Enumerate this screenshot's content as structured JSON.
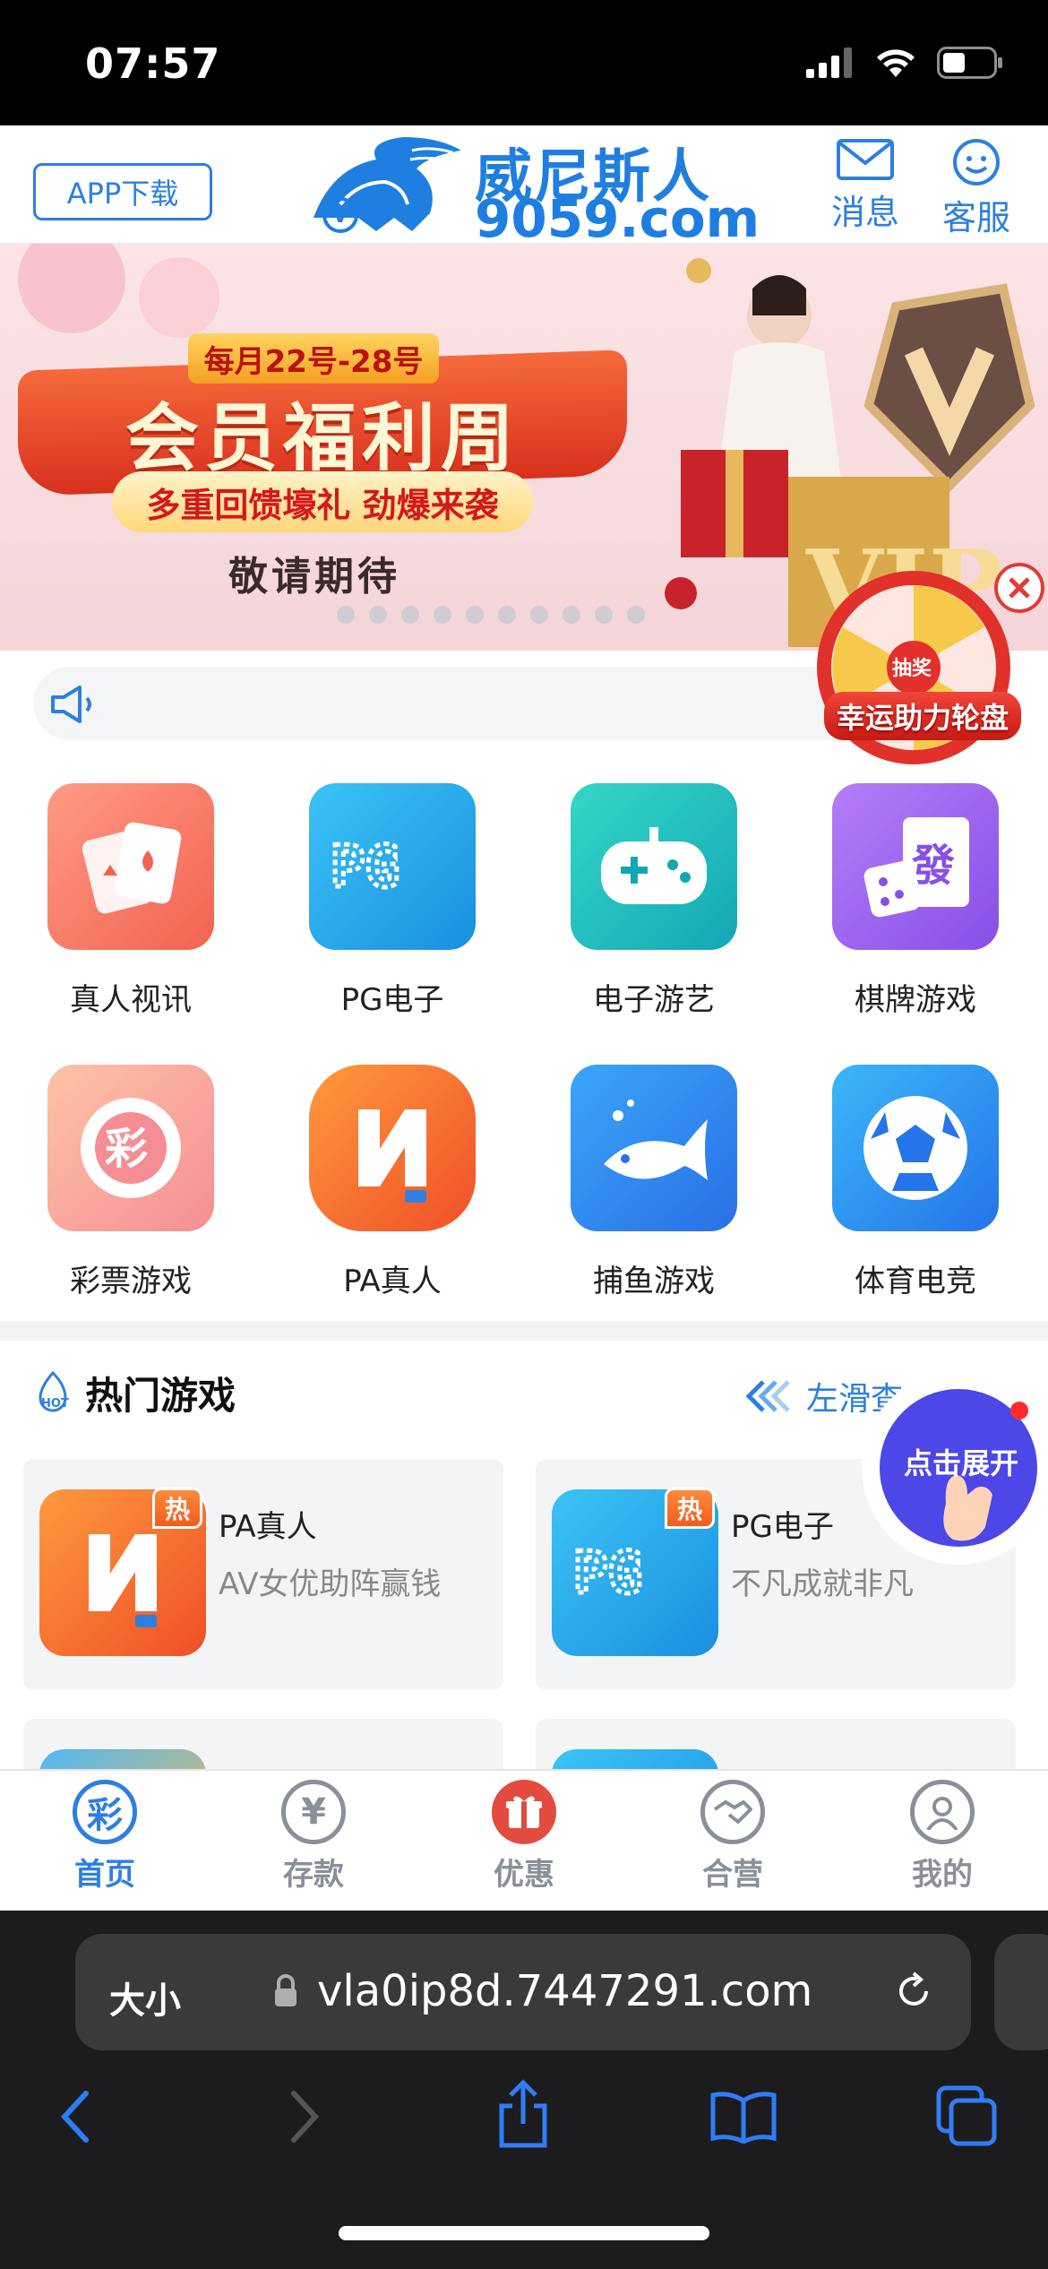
{
  "status": {
    "time": "07:57"
  },
  "header": {
    "app_download": "APP下载",
    "logo_name": "威尼斯人",
    "logo_domain": "9059.com",
    "messages_label": "消息",
    "service_label": "客服"
  },
  "banner": {
    "date_range": "每月22号-28号",
    "title": "会员福利周",
    "subtitle": "多重回馈壕礼 劲爆来袭",
    "note": "敬请期待",
    "vip_text": "VIP"
  },
  "wheel": {
    "label": "幸运助力轮盘",
    "center": "抽奖"
  },
  "categories": [
    {
      "label": "真人视讯"
    },
    {
      "label": "PG电子"
    },
    {
      "label": "电子游艺"
    },
    {
      "label": "棋牌游戏"
    },
    {
      "label": "彩票游戏"
    },
    {
      "label": "PA真人"
    },
    {
      "label": "捕鱼游戏"
    },
    {
      "label": "体育电竞"
    }
  ],
  "hot": {
    "title": "热门游戏",
    "slide_hint": "左滑查",
    "badge": "热",
    "games": [
      {
        "name": "PA真人",
        "desc": "AV女优助阵赢钱"
      },
      {
        "name": "PG电子",
        "desc": "不凡成就非凡"
      }
    ]
  },
  "expand": {
    "label": "点击展开"
  },
  "tabbar": {
    "items": [
      {
        "label": "首页"
      },
      {
        "label": "存款"
      },
      {
        "label": "优惠"
      },
      {
        "label": "合营"
      },
      {
        "label": "我的"
      }
    ]
  },
  "browser": {
    "text_size": "大小",
    "url": "vla0ip8d.7447291.com"
  },
  "colors": {
    "brand_blue": "#2d7fe0",
    "accent_red": "#e23b35"
  }
}
